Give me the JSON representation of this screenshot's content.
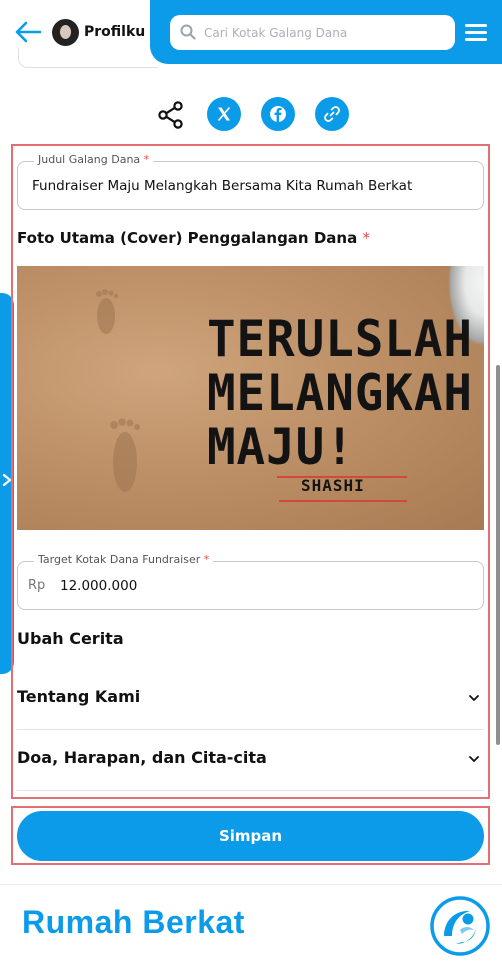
{
  "header": {
    "back_icon": "arrow-left-icon",
    "profile_label": "Profilku",
    "search_placeholder": "Cari Kotak Galang Dana",
    "accent_color": "#0b9be8"
  },
  "share": {
    "icons": [
      "share-icon",
      "x-twitter-icon",
      "facebook-icon",
      "link-icon"
    ]
  },
  "form": {
    "title_field": {
      "label": "Judul Galang Dana",
      "required_mark": "*",
      "value": "Fundraiser Maju Melangkah Bersama Kita Rumah Berkat"
    },
    "cover": {
      "label": "Foto Utama (Cover) Penggalangan Dana",
      "required_mark": "*",
      "image_text_lines": [
        "TERULSLAH",
        "MELANGKAH",
        "MAJU!"
      ],
      "image_signature": "SHASHI"
    },
    "target_field": {
      "label": "Target Kotak Dana Fundraiser",
      "required_mark": "*",
      "prefix": "Rp",
      "value": "12.000.000"
    },
    "story_heading": "Ubah Cerita",
    "accordions": [
      {
        "title": "Tentang Kami"
      },
      {
        "title": "Doa, Harapan, dan Cita-cita"
      }
    ]
  },
  "actions": {
    "save_label": "Simpan"
  },
  "footer": {
    "brand": "Rumah Berkat"
  }
}
